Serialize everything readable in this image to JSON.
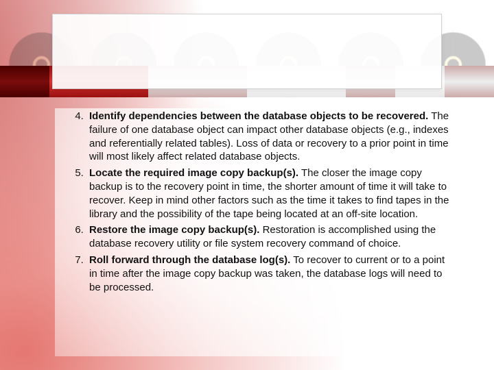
{
  "list": {
    "start": 4,
    "items": [
      {
        "lead": "Identify dependencies between the database objects to be recovered.",
        "body": " The failure of one database object can impact other database objects (e.g., indexes and referentially related tables). Loss of data or recovery to a prior point in time will most likely affect related database objects."
      },
      {
        "lead": "Locate the required image copy backup(s).",
        "body": " The closer the image copy backup is to the recovery point in time, the shorter amount of time it will take to recover. Keep in mind other factors such as the time it takes to find tapes in the library and the possibility of the tape being located at an off-site location."
      },
      {
        "lead": "Restore the image copy backup(s).",
        "body": " Restoration is accomplished using the database recovery utility or file system recovery command of choice."
      },
      {
        "lead": "Roll forward through the database log(s).",
        "body": " To recover to current or to a point in time after the image copy backup was taken, the database logs will need to be processed."
      }
    ]
  }
}
